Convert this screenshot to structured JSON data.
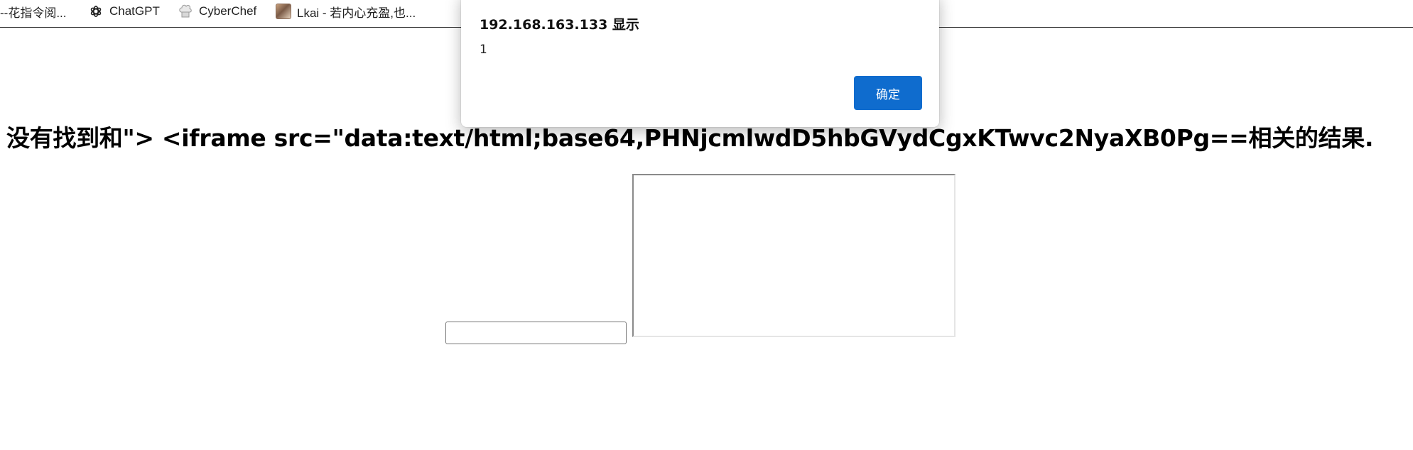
{
  "bookmarks": [
    {
      "label": "--花指令阅...",
      "icon": "none"
    },
    {
      "label": "ChatGPT",
      "icon": "openai-icon"
    },
    {
      "label": "CyberChef",
      "icon": "chef-hat-icon"
    },
    {
      "label": "Lkai - 若内心充盈,也...",
      "icon": "avatar-image"
    }
  ],
  "page": {
    "heading": "没有找到和\"> <iframe src=\"data:text/html;base64,PHNjcmlwdD5hbGVydCgxKTwvc2NyaXB0Pg==相关的结果."
  },
  "alert": {
    "title": "192.168.163.133 显示",
    "message": "1",
    "ok_label": "确定",
    "accent": "#0f6cce"
  }
}
